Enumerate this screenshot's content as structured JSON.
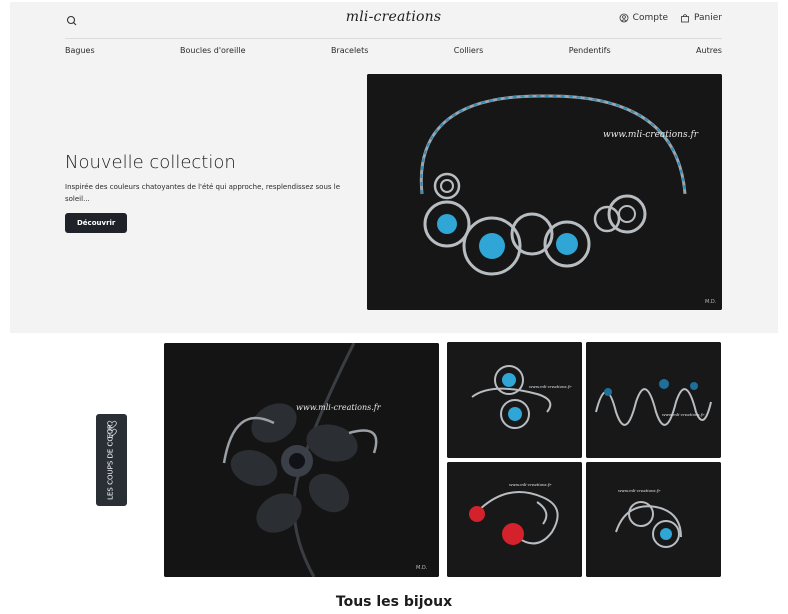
{
  "header": {
    "logo": "mli-creations",
    "account_label": "Compte",
    "cart_label": "Panier"
  },
  "nav": {
    "items": [
      "Bagues",
      "Boucles d'oreille",
      "Bracelets",
      "Colliers",
      "Pendentifs",
      "Autres"
    ]
  },
  "hero": {
    "title": "Nouvelle collection",
    "description": "Inspirée des couleurs chatoyantes de l'été qui approche, resplendissez sous le soleil...",
    "button_label": "Découvrir",
    "image_watermark": "www.mli-creations.fr",
    "image_credit": "M.D."
  },
  "favorites": {
    "tab_label": "LES COUPS DE CŒUR",
    "main_watermark": "www.mli-creations.fr",
    "main_credit": "M.D.",
    "thumb_watermark": "www.mli-creations.fr"
  },
  "section": {
    "title": "Tous les bijoux"
  },
  "colors": {
    "hero_background": "#f3f3f3",
    "button_background": "#1f2329",
    "bead_blue": "#2fa6d6",
    "bead_red": "#d3222c"
  }
}
